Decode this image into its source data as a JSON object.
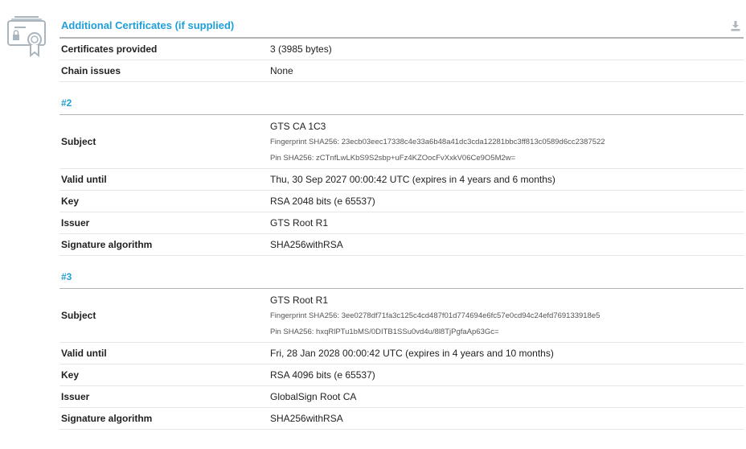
{
  "section": {
    "title": "Additional Certificates (if supplied)",
    "icon": "certificate-icon",
    "download_icon": "download-icon"
  },
  "summary": {
    "certificates_provided": {
      "label": "Certificates provided",
      "value": "3 (3985 bytes)"
    },
    "chain_issues": {
      "label": "Chain issues",
      "value": "None"
    }
  },
  "certs": [
    {
      "heading": "#2",
      "subject_label": "Subject",
      "subject": "GTS CA 1C3",
      "fingerprint": "Fingerprint SHA256: 23ecb03eec17338c4e33a6b48a41dc3cda12281bbc3ff813c0589d6cc2387522",
      "pin": "Pin SHA256: zCTnfLwLKbS9S2sbp+uFz4KZOocFvXxkV06Ce9O5M2w=",
      "valid_label": "Valid until",
      "valid_until": "Thu, 30 Sep 2027 00:00:42 UTC (expires in 4 years and 6 months)",
      "key_label": "Key",
      "key": "RSA 2048 bits (e 65537)",
      "issuer_label": "Issuer",
      "issuer": "GTS Root R1",
      "sigalg_label": "Signature algorithm",
      "sigalg": "SHA256withRSA"
    },
    {
      "heading": "#3",
      "subject_label": "Subject",
      "subject": "GTS Root R1",
      "fingerprint": "Fingerprint SHA256: 3ee0278df71fa3c125c4cd487f01d774694e6fc57e0cd94c24efd769133918e5",
      "pin": "Pin SHA256: hxqRlPTu1bMS/0DITB1SSu0vd4u/8l8TjPgfaAp63Gc=",
      "valid_label": "Valid until",
      "valid_until": "Fri, 28 Jan 2028 00:00:42 UTC (expires in 4 years and 10 months)",
      "key_label": "Key",
      "key": "RSA 4096 bits (e 65537)",
      "issuer_label": "Issuer",
      "issuer": "GlobalSign Root CA",
      "sigalg_label": "Signature algorithm",
      "sigalg": "SHA256withRSA"
    }
  ]
}
